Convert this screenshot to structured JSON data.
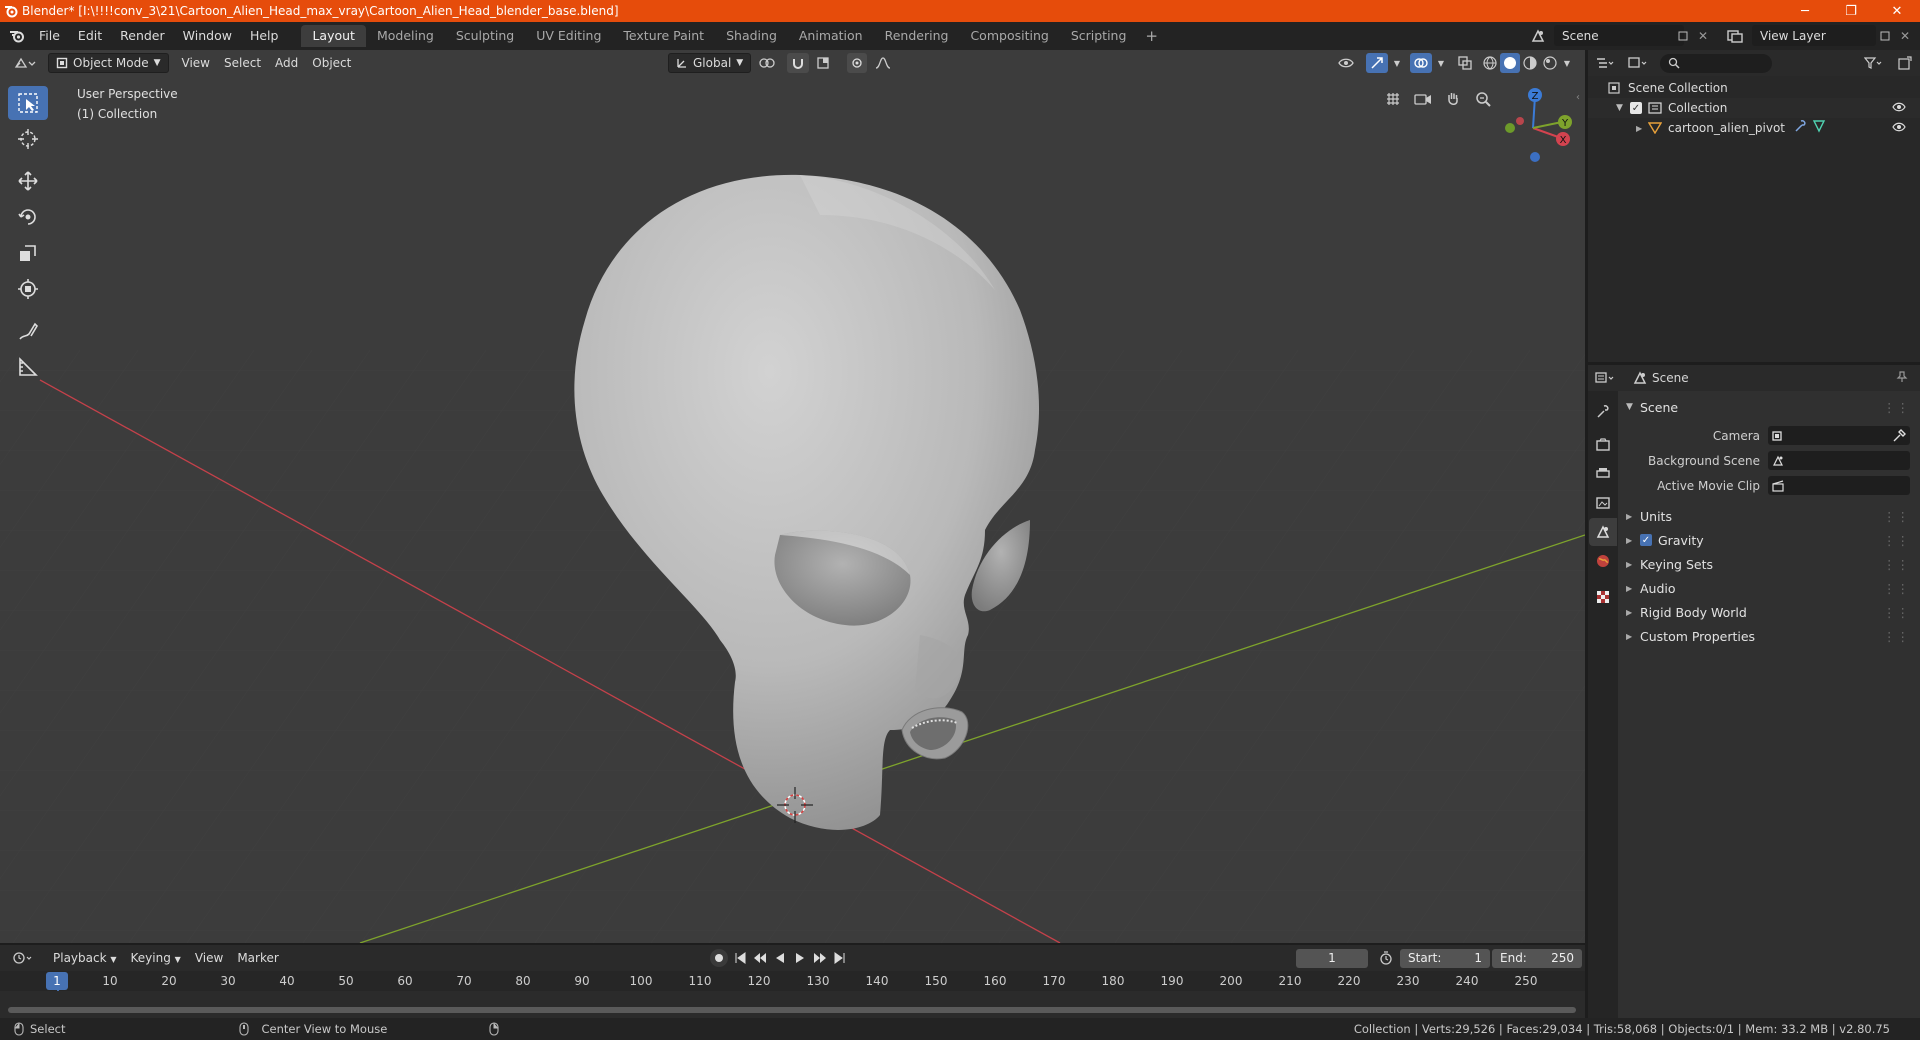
{
  "window": {
    "title": "Blender* [I:\\!!!!conv_3\\21\\Cartoon_Alien_Head_max_vray\\Cartoon_Alien_Head_blender_base.blend]",
    "minimize": "─",
    "maximize": "❐",
    "close": "✕"
  },
  "menu": [
    "File",
    "Edit",
    "Render",
    "Window",
    "Help"
  ],
  "workspaces": [
    "Layout",
    "Modeling",
    "Sculpting",
    "UV Editing",
    "Texture Paint",
    "Shading",
    "Animation",
    "Rendering",
    "Compositing",
    "Scripting"
  ],
  "active_workspace": "Layout",
  "workspace_add": "+",
  "scene_selector": "Scene",
  "view_layer": "View Layer",
  "viewport_header": {
    "mode": "Object Mode",
    "menus": [
      "View",
      "Select",
      "Add",
      "Object"
    ],
    "transform_orientation": "Global"
  },
  "viewport_info": {
    "perspective": "User Perspective",
    "collection": "(1) Collection"
  },
  "gizmo": {
    "x": "X",
    "y": "Y",
    "z": "Z"
  },
  "outliner": {
    "root": "Scene Collection",
    "collection": "Collection",
    "object": "cartoon_alien_pivot"
  },
  "properties": {
    "header": "Scene",
    "panel": "Scene",
    "fields": [
      {
        "label": "Camera",
        "value": ""
      },
      {
        "label": "Background Scene",
        "value": ""
      },
      {
        "label": "Active Movie Clip",
        "value": ""
      }
    ],
    "sections": [
      "Units",
      "Gravity",
      "Keying Sets",
      "Audio",
      "Rigid Body World",
      "Custom Properties"
    ],
    "gravity_checked": true
  },
  "timeline": {
    "menus": [
      "Playback",
      "Keying",
      "View",
      "Marker"
    ],
    "current_frame": "1",
    "start_label": "Start:",
    "start": "1",
    "end_label": "End:",
    "end": "250",
    "ruler_ticks": [
      "1",
      "10",
      "20",
      "30",
      "40",
      "50",
      "60",
      "70",
      "80",
      "90",
      "100",
      "110",
      "120",
      "130",
      "140",
      "150",
      "160",
      "170",
      "180",
      "190",
      "200",
      "210",
      "220",
      "230",
      "240",
      "250"
    ]
  },
  "statusbar": {
    "left_action": "Select",
    "middle_action": "Center View to Mouse",
    "stats": "Collection | Verts:29,526 | Faces:29,034 | Tris:58,068 | Objects:0/1 | Mem: 33.2 MB | v2.80.75"
  },
  "colors": {
    "titlebar": "#e64c0b",
    "viewport_bg": "#3c3c3c",
    "active_blue": "#4772b3",
    "x_axis": "#d3434f",
    "y_axis": "#7ea32c",
    "z_axis": "#3b7bd6"
  }
}
